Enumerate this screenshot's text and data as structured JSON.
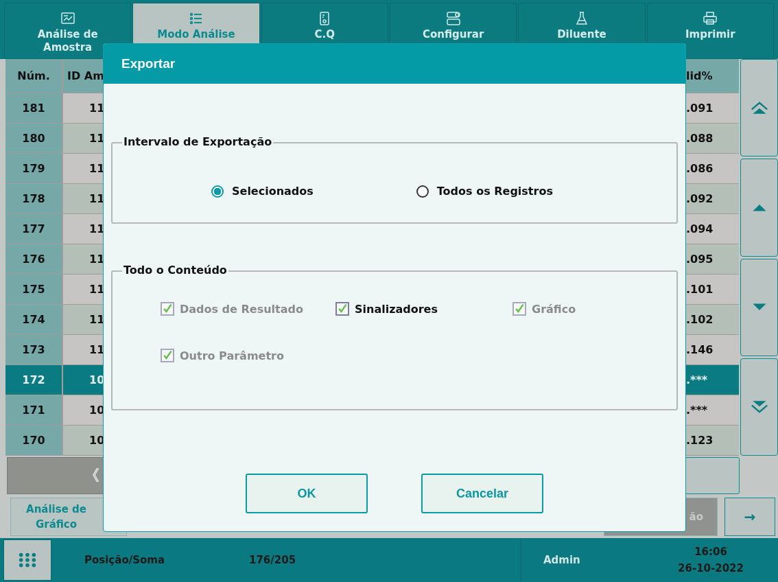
{
  "toolbar": {
    "tabs": [
      {
        "label": "Análise de Amostra",
        "selected": false
      },
      {
        "label": "Modo Análise",
        "selected": true
      },
      {
        "label": "C.Q",
        "selected": false
      },
      {
        "label": "Configurar",
        "selected": false
      },
      {
        "label": "Diluente",
        "selected": false
      },
      {
        "label": "Imprimir",
        "selected": false
      }
    ]
  },
  "table": {
    "columns": [
      "Núm.",
      "ID Am",
      "lid%"
    ],
    "rows": [
      {
        "num": "181",
        "id": "11",
        "value": ".091",
        "selected": false
      },
      {
        "num": "180",
        "id": "11",
        "value": ".088",
        "selected": false
      },
      {
        "num": "179",
        "id": "11",
        "value": ".086",
        "selected": false
      },
      {
        "num": "178",
        "id": "11",
        "value": ".092",
        "selected": false
      },
      {
        "num": "177",
        "id": "11",
        "value": ".094",
        "selected": false
      },
      {
        "num": "176",
        "id": "11",
        "value": ".095",
        "selected": false
      },
      {
        "num": "175",
        "id": "11",
        "value": ".101",
        "selected": false
      },
      {
        "num": "174",
        "id": "11",
        "value": ".102",
        "selected": false
      },
      {
        "num": "173",
        "id": "11",
        "value": ".146",
        "selected": false
      },
      {
        "num": "172",
        "id": "10",
        "value": ".***",
        "selected": true
      },
      {
        "num": "171",
        "id": "10",
        "value": ".***",
        "selected": false
      },
      {
        "num": "170",
        "id": "10",
        "value": ".123",
        "selected": false
      }
    ]
  },
  "pager": {
    "previous": "《"
  },
  "bottom_buttons": [
    {
      "label": "Análise de Gráfico",
      "disabled": false
    },
    {
      "label": "ão",
      "disabled": true
    }
  ],
  "next_button": "→",
  "status_bar": {
    "position_label": "Posição/Soma",
    "position": "176/205",
    "user": "Admin",
    "time": "16:06",
    "date": "26-10-2022"
  },
  "dialog": {
    "title": "Exportar",
    "range": {
      "legend": "Intervalo de Exportação",
      "options": [
        {
          "label": "Selecionados",
          "selected": true
        },
        {
          "label": "Todos os Registros",
          "selected": false
        }
      ]
    },
    "content": {
      "legend": "Todo o Conteúdo",
      "options": [
        {
          "label": "Dados de Resultado",
          "checked": true,
          "disabled": true
        },
        {
          "label": "Sinalizadores",
          "checked": true,
          "disabled": false
        },
        {
          "label": "Gráfico",
          "checked": true,
          "disabled": true
        },
        {
          "label": "Outro Parâmetro",
          "checked": true,
          "disabled": true
        }
      ]
    },
    "buttons": [
      "OK",
      "Cancelar"
    ]
  }
}
